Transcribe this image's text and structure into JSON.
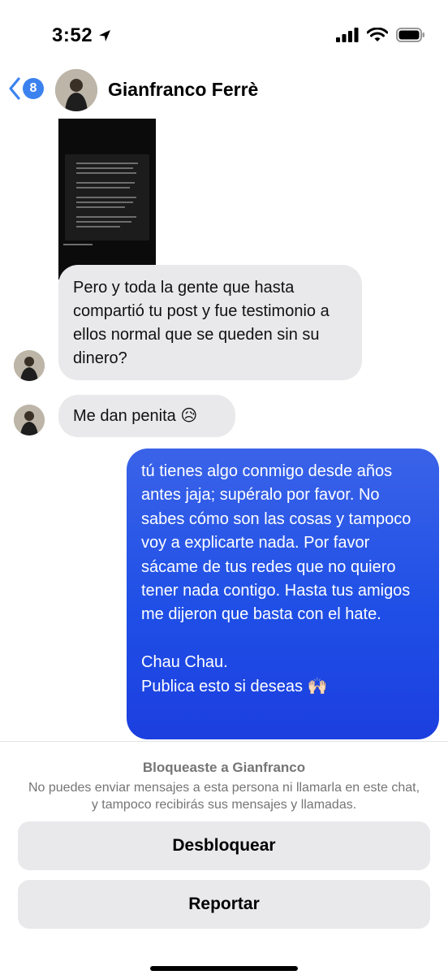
{
  "status_bar": {
    "time": "3:52"
  },
  "header": {
    "back_count": "8",
    "contact_name": "Gianfranco Ferrè"
  },
  "messages": {
    "incoming_1": "Pero y toda la gente que hasta compartió tu post y fue testimonio a ellos normal que se queden sin su dinero?",
    "incoming_2": "Me dan penita 😥",
    "outgoing_1": "tú tienes algo conmigo desde años antes jaja; supéralo por favor. No sabes cómo son las cosas y tampoco voy a explicarte nada. Por favor sácame de tus redes que no quiero tener nada contigo. Hasta tus amigos me dijeron que basta con el hate.\n\nChau Chau.\nPublica esto si deseas 🙌🏻"
  },
  "blocked": {
    "title": "Bloqueaste a Gianfranco",
    "description": "No puedes enviar mensajes a esta persona ni llamarla en este chat, y tampoco recibirás sus mensajes y llamadas.",
    "unblock_label": "Desbloquear",
    "report_label": "Reportar"
  },
  "colors": {
    "accent": "#3b82f0",
    "outgoing_bubble": "#1f4fe6",
    "incoming_bubble": "#e9e9eb"
  }
}
